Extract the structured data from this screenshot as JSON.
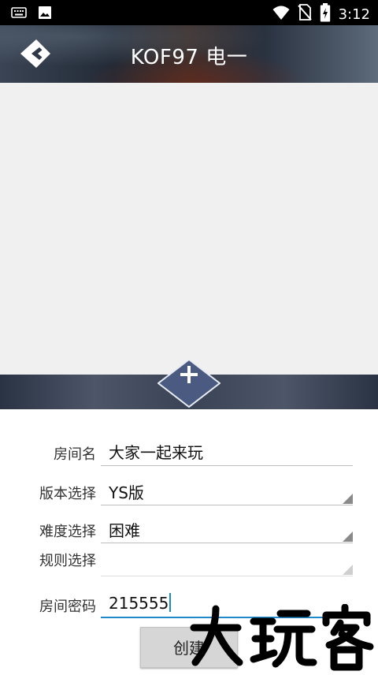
{
  "status_bar": {
    "time": "3:12",
    "left_icons": [
      "keyboard-icon",
      "image-icon"
    ],
    "right_icons": [
      "wifi-icon",
      "no-sim-icon",
      "battery-charging-icon"
    ]
  },
  "header": {
    "title": "KOF97 电一",
    "back_icon": "back-arrow-icon"
  },
  "add_button": {
    "icon": "plus-icon",
    "label": "+"
  },
  "form": {
    "room_name": {
      "label": "房间名",
      "value": "大家一起来玩"
    },
    "version": {
      "label": "版本选择",
      "value": "YS版"
    },
    "difficulty": {
      "label": "难度选择",
      "value": "困难"
    },
    "rules": {
      "label": "规则选择",
      "value": ""
    },
    "password": {
      "label": "房间密码",
      "value": "215555"
    }
  },
  "create_button": {
    "label": "创建"
  },
  "watermark": {
    "text": "大玩客"
  },
  "colors": {
    "accent": "#1e88c8",
    "header_dark": "#222a36",
    "add_bar": "#3a4356",
    "preview_bg": "#f0f0f0"
  }
}
